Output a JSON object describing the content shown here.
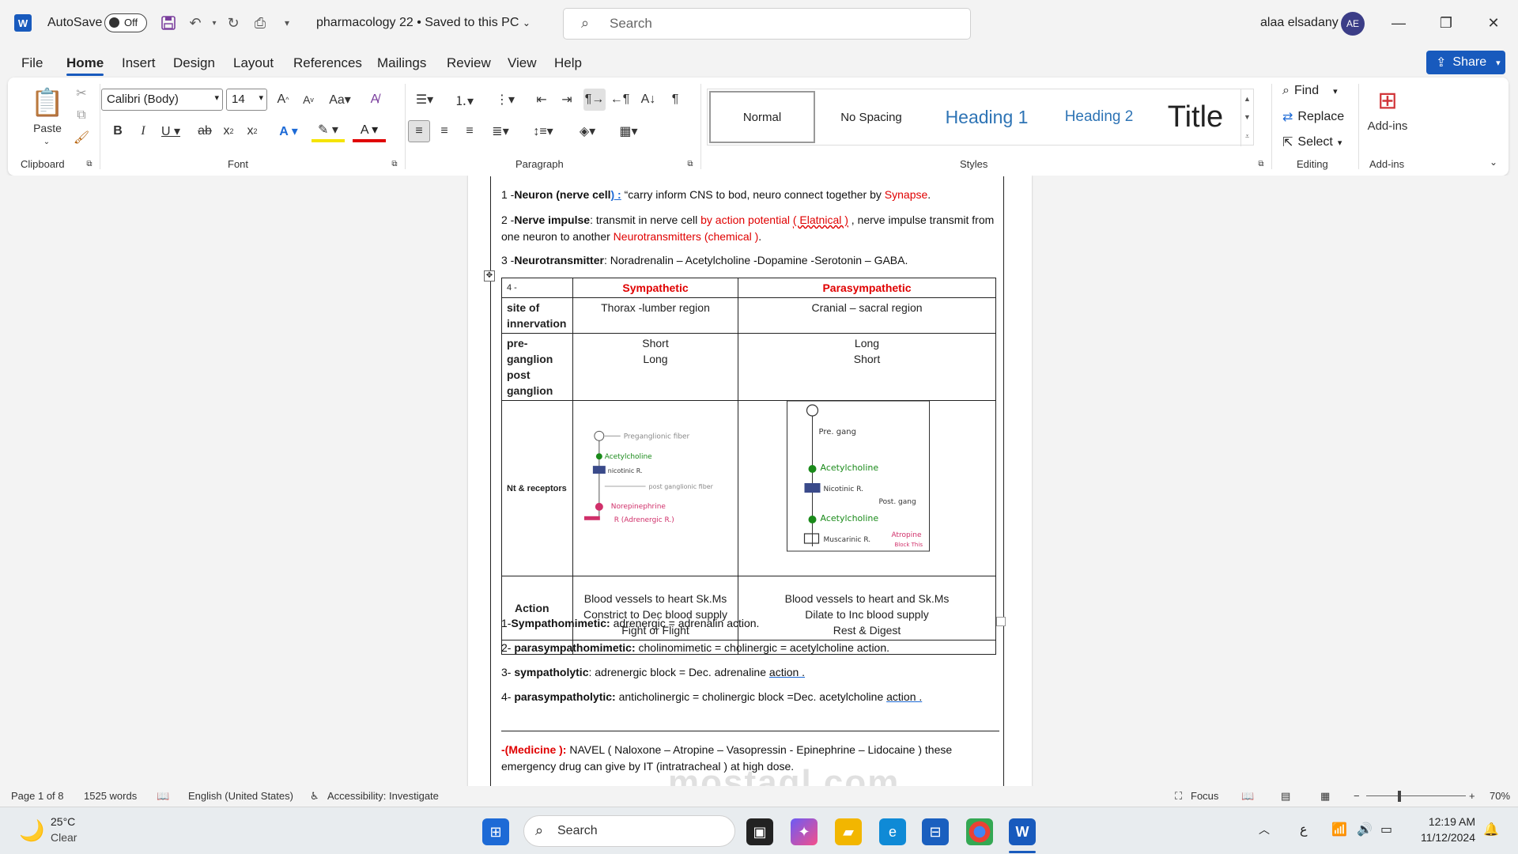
{
  "titlebar": {
    "app_logo": "W",
    "autosave_label": "AutoSave",
    "autosave_state": "Off",
    "doc_title": "pharmacology 22 • Saved to this PC",
    "search_placeholder": "Search",
    "user_name": "alaa elsadany",
    "user_initials": "AE"
  },
  "menu": {
    "tabs": [
      "File",
      "Home",
      "Insert",
      "Design",
      "Layout",
      "References",
      "Mailings",
      "Review",
      "View",
      "Help"
    ],
    "active": "Home",
    "share_label": "Share"
  },
  "ribbon": {
    "clipboard": {
      "label": "Clipboard",
      "paste": "Paste"
    },
    "font": {
      "label": "Font",
      "font_name": "Calibri (Body)",
      "font_size": "14"
    },
    "paragraph": {
      "label": "Paragraph"
    },
    "styles": {
      "label": "Styles",
      "items": [
        "Normal",
        "No Spacing",
        "Heading 1",
        "Heading 2",
        "Title"
      ]
    },
    "editing": {
      "label": "Editing",
      "find": "Find",
      "replace": "Replace",
      "select": "Select"
    },
    "addins": {
      "label": "Add-ins",
      "button": "Add-ins"
    }
  },
  "document": {
    "p1": {
      "num": "1 -",
      "term": "Neuron (nerve cell",
      "paren": ")",
      "colon": " :",
      "text": " “carry inform CNS to bod, neuro connect together by ",
      "red": "Synapse",
      "end": "."
    },
    "p2": {
      "num": "2 -",
      "term": "Nerve impulse",
      "text1": ": transmit in nerve cell ",
      "red1": "by action potential ",
      "red1u": "( Elatnical )",
      "text2": " , nerve impulse transmit from one neuron to another ",
      "red2": "Neurotransmitters (chemical )",
      "end": "."
    },
    "p3": {
      "num": "3 -",
      "term": "Neurotransmitter",
      "text": ": Noradrenalin – Acetylcholine -Dopamine -Serotonin – GABA."
    },
    "table": {
      "corner": "4 -",
      "head_sym": "Sympathetic",
      "head_para": "Parasympathetic",
      "row1_label": "site of innervation",
      "row1_sym": "Thorax -lumber    region",
      "row1_para": "Cranial – sacral     region",
      "row2_label_a": "pre-ganglion",
      "row2_label_b": "post ganglion",
      "row2_sym_a": "Short",
      "row2_sym_b": "Long",
      "row2_para_a": "Long",
      "row2_para_b": "Short",
      "row3_label": "Nt & receptors",
      "sketch_sym": [
        "Preganglionic fiber",
        "Acetylcholine",
        "nicotinic R.",
        "post ganglionic fiber",
        "Norepinephrine",
        "R (Adrenergic R.)"
      ],
      "sketch_para": [
        "Pre. gang",
        "Acetylcholine",
        "Nicotinic R.",
        "Post. gang",
        "Acetylcholine",
        "Muscarinic R.",
        "Atropine",
        "Block This"
      ],
      "row4_label": "Action",
      "row4_sym": [
        "Blood vessels to heart Sk.Ms",
        "Constrict to Dec blood supply",
        "Fight or  Flight"
      ],
      "row4_para": [
        "Blood vessels to heart and Sk.Ms",
        "Dilate to Inc blood supply",
        "Rest & Digest"
      ]
    },
    "list": [
      {
        "num": "1-",
        "term": "Sympathomimetic:",
        "text": " adrenergic = adrenalin action."
      },
      {
        "num": "2- ",
        "term": "parasympathomimetic:",
        "text": " cholinomimetic = cholinergic = acetylcholine action."
      },
      {
        "num": "3- ",
        "term": "sympatholytic",
        "text": ": adrenergic block = Dec. adrenaline ",
        "u": "action ."
      },
      {
        "num": "4- ",
        "term": "parasympatholytic:",
        "text": " anticholinergic = cholinergic block =Dec. acetylcholine ",
        "u": "action ."
      }
    ],
    "medicine": {
      "label": "-(Medicine ):",
      "text": " NAVEL  ( Naloxone – Atropine – Vasopressin - Epinephrine – Lidocaine ) these emergency drug can give by IT (intratracheal ) at high dose."
    }
  },
  "status": {
    "page": "Page 1 of 8",
    "words": "1525 words",
    "language": "English (United States)",
    "accessibility": "Accessibility: Investigate",
    "focus": "Focus",
    "zoom": "70%"
  },
  "taskbar": {
    "temp": "25°C",
    "weather": "Clear",
    "search": "Search",
    "time": "12:19 AM",
    "date": "11/12/2024",
    "lang_indicator": "ع"
  },
  "watermark": "mostaql.com",
  "colors": {
    "accent": "#185abd",
    "red_text": "#e00000",
    "green_ink": "#1a8a1a",
    "pink_ink": "#d0306a"
  }
}
